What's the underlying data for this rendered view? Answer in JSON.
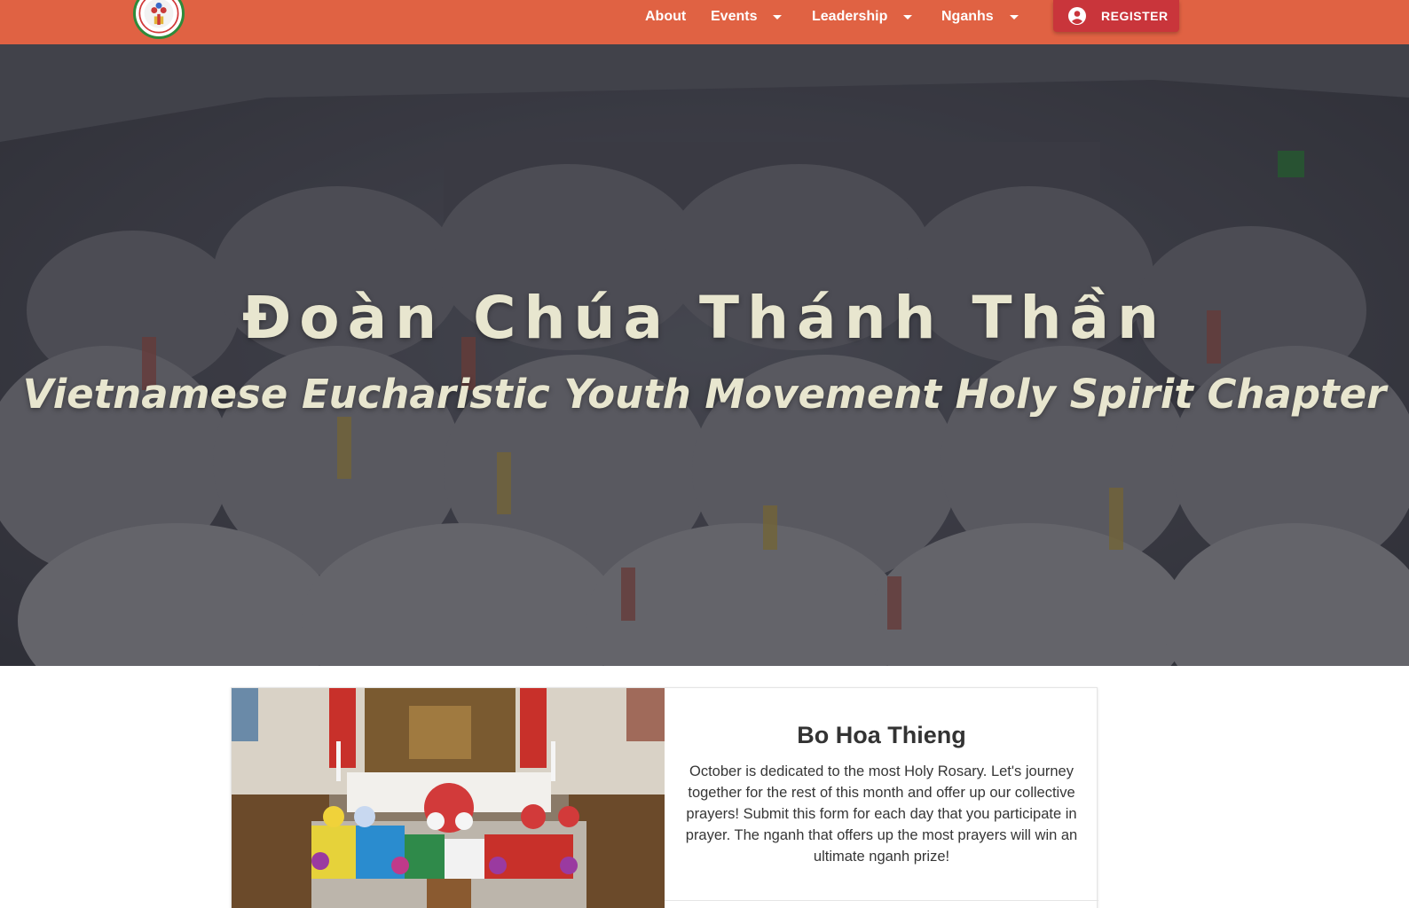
{
  "nav": {
    "logo": "chapter-logo",
    "items": [
      {
        "label": "About",
        "dropdown": false
      },
      {
        "label": "Events",
        "dropdown": true
      },
      {
        "label": "Leadership",
        "dropdown": true
      },
      {
        "label": "Nganhs",
        "dropdown": true
      }
    ],
    "register_label": "REGISTER",
    "colors": {
      "navbar": "#e06243",
      "register": "#c9353b",
      "text": "#ffffff"
    }
  },
  "hero": {
    "title": "Đoàn Chúa Thánh Thần",
    "subtitle": "Vietnamese Eucharistic Youth Movement Holy Spirit Chapter",
    "text_color": "#e8e6cf"
  },
  "card": {
    "image": "altar-flowers-photo",
    "title": "Bo Hoa Thieng",
    "text": "October is dedicated to the most Holy Rosary. Let's journey together for the rest of this month and offer up our collective prayers! Submit this form for each day that you participate in prayer. The nganh that offers up the most prayers will win an ultimate nganh prize!"
  }
}
